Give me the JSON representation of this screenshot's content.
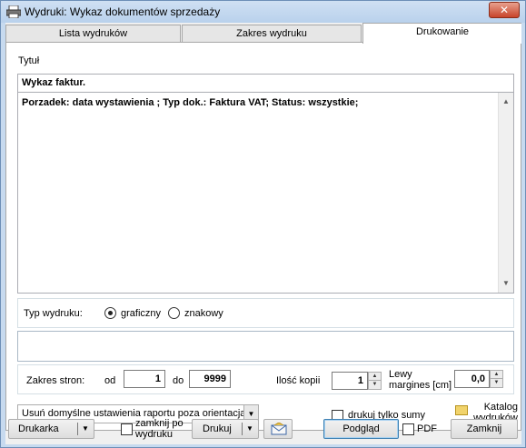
{
  "window": {
    "title": "Wydruki: Wykaz dokumentów sprzedaży",
    "close_glyph": "✕"
  },
  "tabs": [
    {
      "label": "Lista wydruków",
      "active": false
    },
    {
      "label": "Zakres wydruku",
      "active": false
    },
    {
      "label": "Drukowanie",
      "active": true
    }
  ],
  "content": {
    "title_label": "Tytuł",
    "title_value": "Wykaz faktur.",
    "description": "Porzadek: data wystawienia ;  Typ dok.: Faktura VAT; Status: wszystkie;",
    "print_type_label": "Typ wydruku:",
    "print_type_options": [
      {
        "label": "graficzny",
        "selected": true
      },
      {
        "label": "znakowy",
        "selected": false
      }
    ],
    "pages_label": "Zakres stron:",
    "from_label": "od",
    "from_value": "1",
    "to_label": "do",
    "to_value": "9999",
    "copies_label": "Ilość kopii",
    "copies_value": "1",
    "left_margin_label": "Lewy margines [cm]",
    "left_margin_value": "0,0",
    "remove_settings_option": "Usuń domyślne ustawienia raportu poza orientacją i",
    "print_sums_only_label": "drukuj tylko sumy",
    "catalog_label": "Katalog wydruków"
  },
  "bottom_bar": {
    "printer_button": "Drukarka",
    "close_after_print_label": "zamknij po wydruku",
    "print_button": "Drukuj",
    "preview_button": "Podgląd",
    "pdf_label": "PDF",
    "close_button": "Zamknij"
  }
}
